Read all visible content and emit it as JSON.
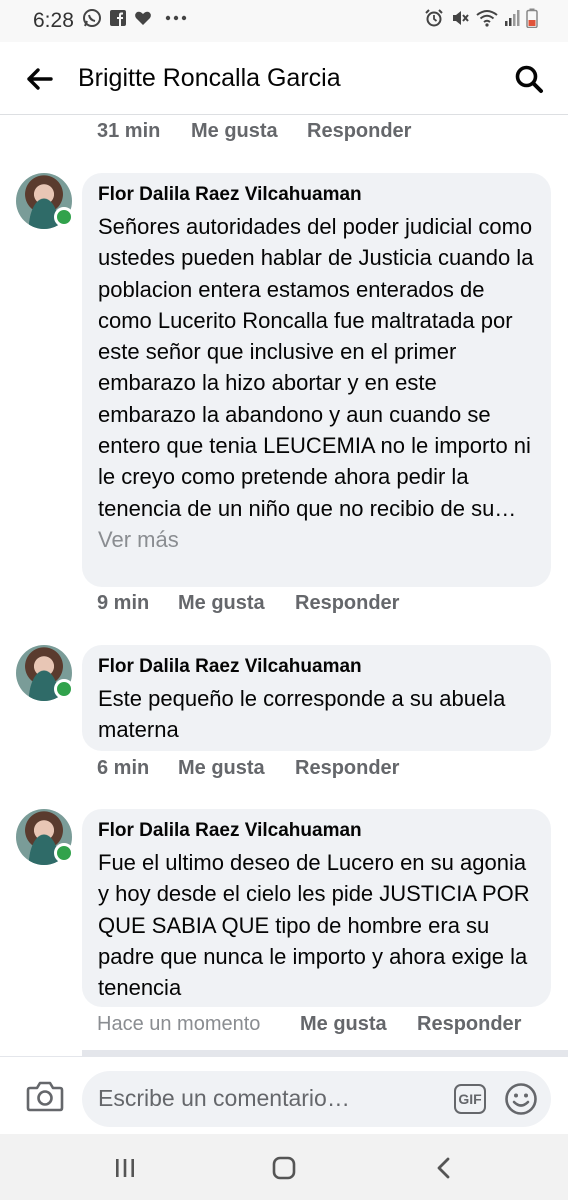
{
  "status_bar": {
    "time": "6:28"
  },
  "header": {
    "title": "Brigitte Roncalla Garcia"
  },
  "prev_comment_meta": {
    "time": "31 min",
    "like": "Me gusta",
    "reply": "Responder"
  },
  "comments": [
    {
      "author": "Flor Dalila Raez Vilcahuaman",
      "text": "Señores autoridades del poder judicial como ustedes pueden hablar de Justicia cuando la poblacion entera estamos enterados de como Lucerito Roncalla fue maltratada por este señor que inclusive en el primer embarazo la hizo abortar y en este embarazo la abandono y aun cuando se entero que tenia LEUCEMIA no le importo ni le creyo como pretende ahora pedir la tenencia de un niño que no recibio de su…",
      "see_more": "Ver más",
      "time": "9 min",
      "like": "Me gusta",
      "reply": "Responder"
    },
    {
      "author": "Flor Dalila Raez Vilcahuaman",
      "text": "Este pequeño le corresponde a su abuela materna",
      "time": "6 min",
      "like": "Me gusta",
      "reply": "Responder"
    },
    {
      "author": "Flor Dalila Raez Vilcahuaman",
      "text": "Fue el ultimo deseo de Lucero en su agonia y hoy desde el cielo les pide JUSTICIA POR QUE SABIA QUE tipo de hombre era su padre que nunca le importo y ahora exige la tenencia",
      "time": "Hace un momento",
      "like": "Me gusta",
      "reply": "Responder"
    }
  ],
  "composer": {
    "placeholder": "Escribe un comentario…",
    "gif": "GIF"
  },
  "icons": {
    "status": [
      "whatsapp-icon",
      "facebook-icon",
      "heart-icon",
      "more-dots-icon",
      "alarm-icon",
      "mute-icon",
      "wifi-icon",
      "signal-icon",
      "battery-icon"
    ],
    "header": [
      "back-arrow-icon",
      "search-icon"
    ],
    "composer": [
      "camera-icon",
      "gif-icon",
      "emoji-icon"
    ],
    "nav": [
      "recent-apps-icon",
      "home-icon",
      "back-icon"
    ]
  },
  "colors": {
    "online": "#31a24c",
    "bubble": "#f0f2f5",
    "meta": "#65676b"
  }
}
